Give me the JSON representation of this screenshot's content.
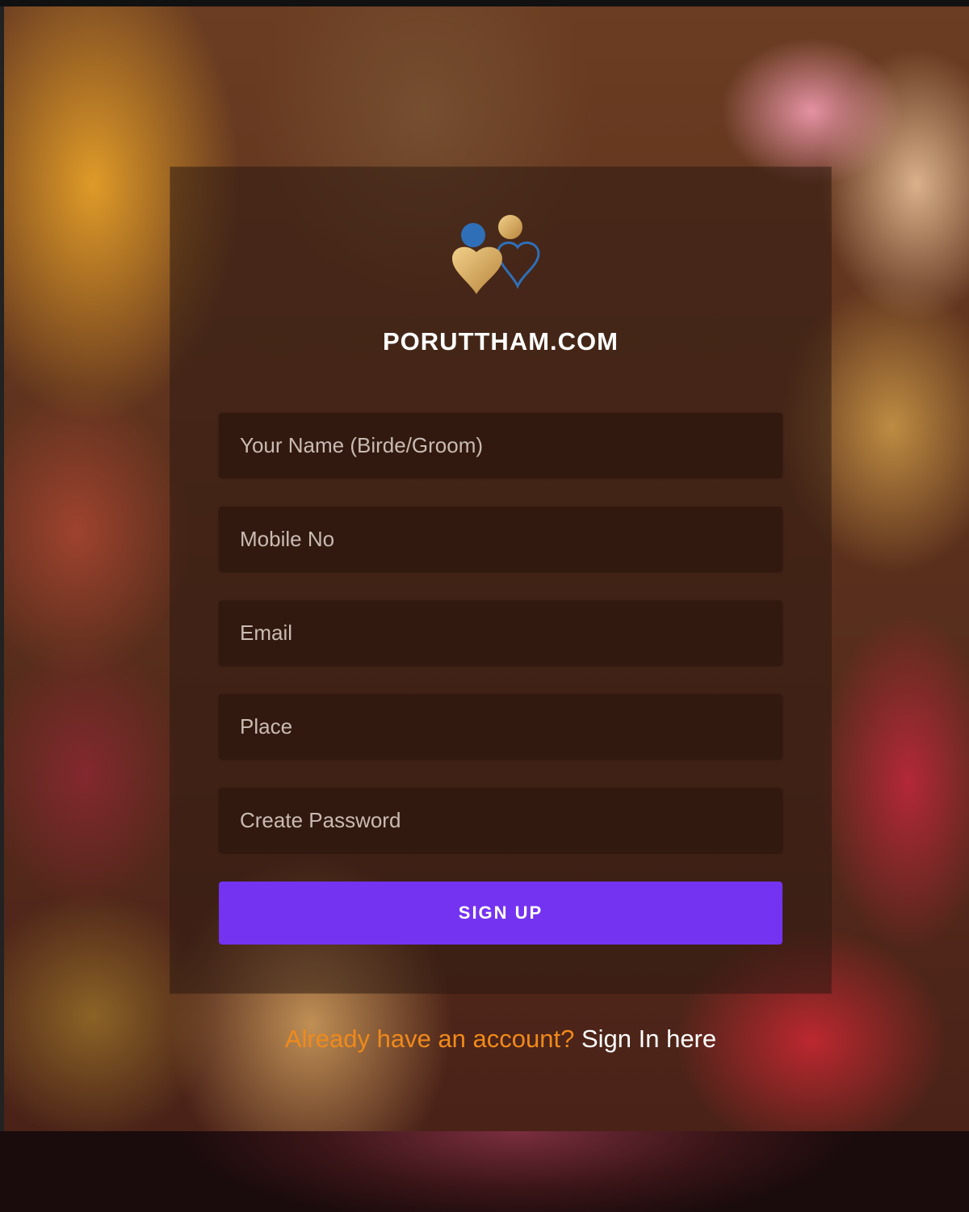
{
  "brand": {
    "name": "PORUTTHAM.COM",
    "logo_icon": "hearts-logo-icon",
    "colors": {
      "gold": "#d4a95a",
      "blue": "#2f6fb8"
    }
  },
  "form": {
    "name_placeholder": "Your Name (Birde/Groom)",
    "mobile_placeholder": "Mobile No",
    "email_placeholder": "Email",
    "place_placeholder": "Place",
    "password_placeholder": "Create Password",
    "submit_label": "SIGN UP",
    "submit_color": "#7433f0",
    "field_color": "#32190f"
  },
  "signin": {
    "question": "Already have an account?",
    "link": "Sign In here",
    "question_color": "#f08a1c"
  }
}
